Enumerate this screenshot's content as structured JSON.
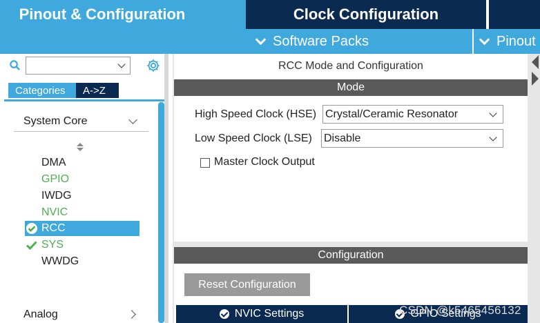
{
  "top_tabs": {
    "pinout": "Pinout & Configuration",
    "clock": "Clock Configuration"
  },
  "subbar": {
    "software_packs": "Software Packs",
    "pinout": "Pinout"
  },
  "left_panel": {
    "search_value": "",
    "tabs": {
      "categories": "Categories",
      "az": "A->Z"
    },
    "groups": {
      "system_core": "System Core",
      "analog": "Analog"
    },
    "peripherals": [
      {
        "label": "DMA",
        "state": "plain"
      },
      {
        "label": "GPIO",
        "state": "green"
      },
      {
        "label": "IWDG",
        "state": "plain"
      },
      {
        "label": "NVIC",
        "state": "green"
      },
      {
        "label": "RCC",
        "state": "selected"
      },
      {
        "label": "SYS",
        "state": "green-check"
      },
      {
        "label": "WWDG",
        "state": "plain"
      }
    ]
  },
  "mode_panel": {
    "title": "RCC Mode and Configuration",
    "mode_header": "Mode",
    "hse_label": "High Speed Clock (HSE)",
    "hse_value": "Crystal/Ceramic Resonator",
    "lse_label": "Low Speed Clock (LSE)",
    "lse_value": "Disable",
    "mco_label": "Master Clock Output",
    "mco_checked": false
  },
  "config_panel": {
    "header": "Configuration",
    "reset_button": "Reset Configuration",
    "tabs": {
      "nvic": "NVIC Settings",
      "gpio": "GPIO Settings"
    }
  },
  "watermark": "CSDN @k5465456132",
  "colors": {
    "accent_blue": "#3fa8dc",
    "dark_navy": "#0a2a52",
    "enabled_green": "#4caf50",
    "header_gray": "#5a5a5a"
  }
}
